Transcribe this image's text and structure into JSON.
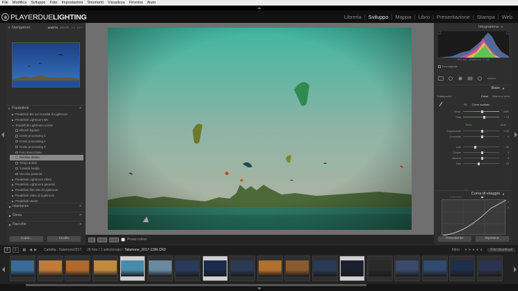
{
  "menu": [
    "File",
    "Modifica",
    "Sviluppo",
    "Foto",
    "Impostazioni",
    "Strumenti",
    "Visualizza",
    "Finestra",
    "Aiuto"
  ],
  "logo": {
    "text_light": "PLAYERDUE",
    "text_bold": "LIGHTING"
  },
  "modules": [
    "Libreria",
    "Sviluppo",
    "Mappa",
    "Libro",
    "Presentazione",
    "Stampa",
    "Web"
  ],
  "modules_sep": "|",
  "left": {
    "navigator_title": "Navigatore",
    "nav_modes": [
      "ADATTA",
      "RIEMPI",
      "1:1",
      "1:2 ÷"
    ],
    "presets_title": "Predefiniti",
    "presets_plus": "+",
    "presets": [
      {
        "label": "Predefiniti BN con tonalità di Lightroom",
        "sub": false
      },
      {
        "label": "Predefiniti Lightroom BN",
        "sub": false
      },
      {
        "label": "Predefiniti Lightroom colore",
        "sub": false
      },
      {
        "label": "Bleach bypass",
        "sub": true
      },
      {
        "label": "Cross processing 1",
        "sub": true
      },
      {
        "label": "Cross processing 2",
        "sub": true
      },
      {
        "label": "Cross processing 3",
        "sub": true
      },
      {
        "label": "Foto invecchiata",
        "sub": true
      },
      {
        "label": "Positivo diretto",
        "sub": true,
        "selected": true
      },
      {
        "label": "Tempi andati",
        "sub": true
      },
      {
        "label": "Tonalità fredda",
        "sub": true
      },
      {
        "label": "Vecchia polaroid",
        "sub": true
      },
      {
        "label": "Predefiniti Lightroom effetti",
        "sub": false
      },
      {
        "label": "Predefiniti Lightroom generali",
        "sub": false
      },
      {
        "label": "Predefiniti filtro BN di Lightroom",
        "sub": false
      },
      {
        "label": "Predefiniti video di Lightroom",
        "sub": false
      },
      {
        "label": "Predefiniti utente",
        "sub": false
      }
    ],
    "sections": [
      "Istantanee",
      "Storia",
      "Raccolte"
    ],
    "plus": "+",
    "copy_btn": "Copia...",
    "paste_btn": "Incolla"
  },
  "toolbar": {
    "soft_proof": "Prova colore"
  },
  "right": {
    "histogram_title": "Istogramma",
    "histogram_info": "ISO 100 · 1/1600 sec · f / 1,0",
    "original_photo": "Foto originale",
    "basic_title": "Base",
    "treatment_label": "Trattamento :",
    "treatment_color": "Colori",
    "treatment_bw": "Bianco e nero",
    "wb_label": "Bil.",
    "wb_value": "Come scattato",
    "temp_label": "Temp.",
    "temp_value": "5060",
    "tint_label": "Tinta",
    "tint_value": "+ 15",
    "tone_label": "Tono",
    "tone_auto": "Auto",
    "sliders_a": [
      {
        "label": "Esposizione",
        "value": "0,00",
        "pos": 0.5
      },
      {
        "label": "Contrasto",
        "value": "0",
        "pos": 0.5
      }
    ],
    "sliders_b": [
      {
        "label": "Luci",
        "value": "- 40",
        "pos": 0.3
      },
      {
        "label": "Ombre",
        "value": "0",
        "pos": 0.5
      },
      {
        "label": "Bianchi",
        "value": "0",
        "pos": 0.5
      },
      {
        "label": "Neri",
        "value": "- 20",
        "pos": 0.4
      }
    ],
    "presence_label": "Presenza",
    "sliders_c": [
      {
        "label": "Chiarezza",
        "value": "0",
        "pos": 0.5
      },
      {
        "label": "Vividezza",
        "value": "0",
        "pos": 0.5
      },
      {
        "label": "Saturazione",
        "value": "0",
        "pos": 0.5
      }
    ],
    "curve_title": "Curva di viraggio",
    "prev_btn": "Precedente",
    "reset_btn": "Ripristina"
  },
  "filmstrip": {
    "pages": [
      "1",
      "2"
    ],
    "folder": "Cartella : Talamone2017",
    "count": "26 foto / 1 selezionata /",
    "filename": "Talamone_2017-1396.CR2",
    "filter_label": "Filtro :",
    "filter_value": "Filtri disattivati"
  },
  "colors": {
    "accent": "#e8e8e8",
    "selected_thumb": "#cfcfcf"
  }
}
